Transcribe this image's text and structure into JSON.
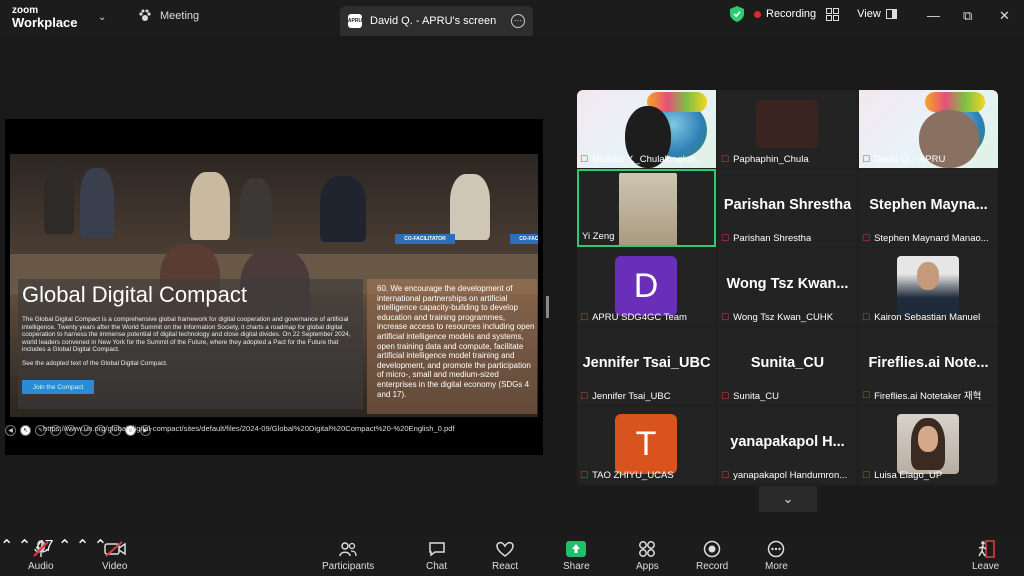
{
  "app": {
    "brand_line1": "zoom",
    "brand_line2": "Workplace",
    "meeting_label": "Meeting"
  },
  "tab": {
    "app_icon_text": "APRU",
    "title": "David Q. - APRU's screen"
  },
  "status": {
    "recording": "Recording",
    "view": "View"
  },
  "slide": {
    "banners": [
      "CO-FACILITATOR",
      "CO-FACILITATOR"
    ],
    "title": "Global Digital Compact",
    "body": "The Global Digital Compact is a comprehensive global framework for digital cooperation and governance of artificial intelligence. Twenty years after the World Summit on the Information Society, it charts a roadmap for global digital cooperation to harness the immense potential of digital technology and close digital divides. On 22 September 2024, world leaders convened in New York for the Summit of the Future, where they adopted a Pact for the Future that includes a Global Digital Compact.",
    "link_text": "See the adopted text of the Global Digital Compact.",
    "button": "Join the Compact",
    "right_text": "60. We encourage the development of international partnerships on artificial intelligence capacity-building to develop education and training programmes, increase access to resources including open artificial intelligence models and systems, open training data and compute, facilitate artificial intelligence model training and development, and promote the participation of micro-, small and medium-sized enterprises in the digital economy (SDGs 4 and 17).",
    "url": "https://www.un.org/global-digital-compact/sites/default/files/2024-09/Global%20Digital%20Compact%20-%20English_0.pdf"
  },
  "participants": [
    {
      "name": "Michiko Y._Chulalongkor...",
      "big": ""
    },
    {
      "name": "Paphaphin_Chula",
      "big": ""
    },
    {
      "name": "David Q. - APRU",
      "big": ""
    },
    {
      "name": "Yi Zeng",
      "big": ""
    },
    {
      "name": "Parishan Shrestha",
      "big": "Parishan Shrestha"
    },
    {
      "name": "Stephen Maynard Manao...",
      "big": "Stephen  Mayna..."
    },
    {
      "name": "APRU SDG4GC Team",
      "big": "D"
    },
    {
      "name": "Wong Tsz Kwan_CUHK",
      "big": "Wong  Tsz  Kwan..."
    },
    {
      "name": "Kairon Sebastian Manuel",
      "big": ""
    },
    {
      "name": "Jennifer Tsai_UBC",
      "big": "Jennifer Tsai_UBC"
    },
    {
      "name": "Sunita_CU",
      "big": "Sunita_CU"
    },
    {
      "name": "Fireflies.ai Notetaker 재혁",
      "big": "Fireflies.ai  Note..."
    },
    {
      "name": "TAO ZHIYU_UCAS",
      "big": "T"
    },
    {
      "name": "yanapakapol Handumron...",
      "big": "yanapakapol  H..."
    },
    {
      "name": "Luisa Elago_UP",
      "big": ""
    }
  ],
  "toolbar": {
    "audio": "Audio",
    "video": "Video",
    "participants": "Participants",
    "participants_count": "47",
    "chat": "Chat",
    "react": "React",
    "share": "Share",
    "apps": "Apps",
    "record": "Record",
    "more": "More",
    "leave": "Leave"
  },
  "colors": {
    "accent": "#2ecc71",
    "record_red": "#e02828",
    "share_green": "#1fbf6a",
    "avatar_d": "#6a2fb8",
    "avatar_t": "#d9531e"
  }
}
